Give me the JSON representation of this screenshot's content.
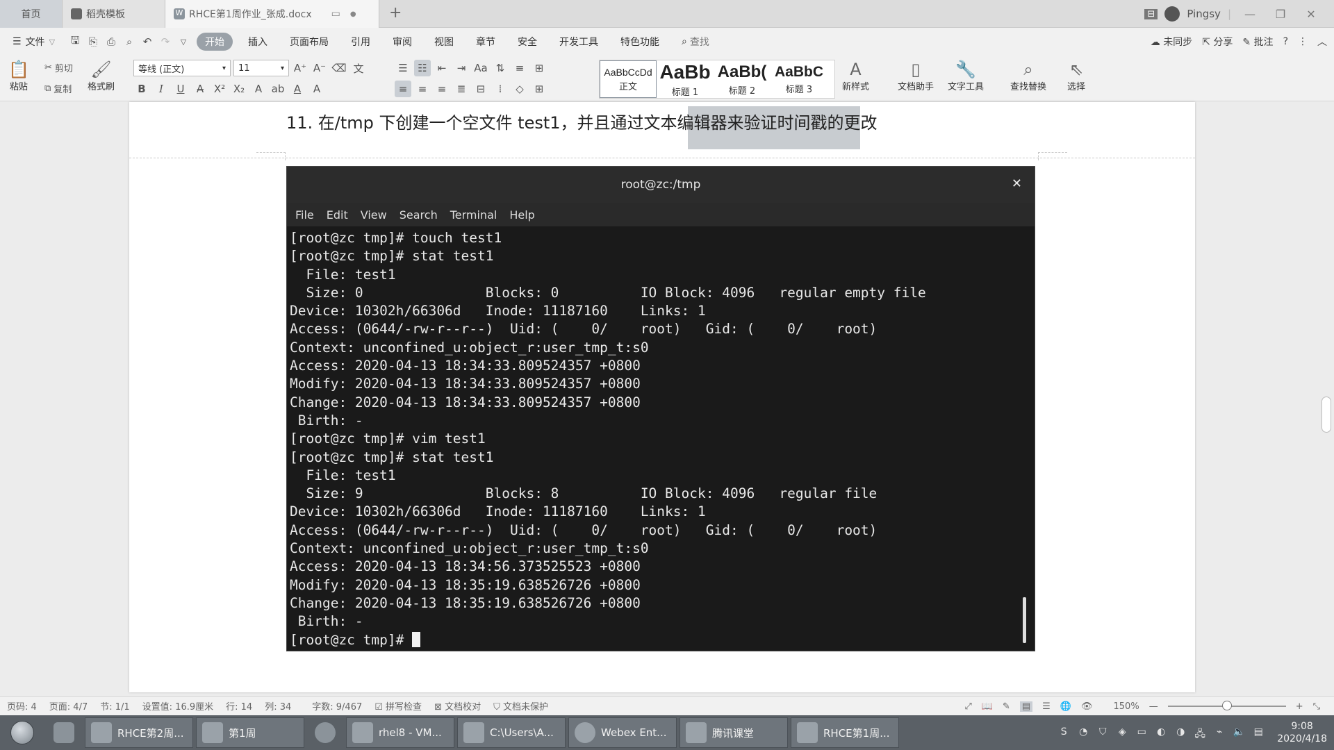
{
  "tabs": {
    "home": "首页",
    "template": "稻壳模板",
    "document": "RHCE第1周作业_张成.docx",
    "add": "+"
  },
  "user": {
    "name": "Pingsy"
  },
  "menu": {
    "file": "文件",
    "items": [
      "开始",
      "插入",
      "页面布局",
      "引用",
      "审阅",
      "视图",
      "章节",
      "安全",
      "开发工具",
      "特色功能"
    ],
    "search": "查找",
    "right": [
      "未同步",
      "分享",
      "批注"
    ]
  },
  "ribbon": {
    "paste": "粘贴",
    "cut": "剪切",
    "copy": "复制",
    "format_painter": "格式刷",
    "font_name": "等线 (正文)",
    "font_size": "11",
    "styles": [
      {
        "sample": "AaBbCcDd",
        "label": "正文"
      },
      {
        "sample": "AaBb",
        "label": "标题 1"
      },
      {
        "sample": "AaBb(",
        "label": "标题 2"
      },
      {
        "sample": "AaBbC",
        "label": "标题 3"
      }
    ],
    "new_style": "新样式",
    "doc_assistant": "文档助手",
    "text_tools": "文字工具",
    "find_replace": "查找替换",
    "select": "选择"
  },
  "document": {
    "heading": "11. 在/tmp 下创建一个空文件 test1，并且通过文本编辑器来验证时间戳的更改"
  },
  "terminal": {
    "title": "root@zc:/tmp",
    "menu": [
      "File",
      "Edit",
      "View",
      "Search",
      "Terminal",
      "Help"
    ],
    "lines": [
      "[root@zc tmp]# touch test1",
      "[root@zc tmp]# stat test1",
      "  File: test1",
      "  Size: 0               Blocks: 0          IO Block: 4096   regular empty file",
      "Device: 10302h/66306d   Inode: 11187160    Links: 1",
      "Access: (0644/-rw-r--r--)  Uid: (    0/    root)   Gid: (    0/    root)",
      "Context: unconfined_u:object_r:user_tmp_t:s0",
      "Access: 2020-04-13 18:34:33.809524357 +0800",
      "Modify: 2020-04-13 18:34:33.809524357 +0800",
      "Change: 2020-04-13 18:34:33.809524357 +0800",
      " Birth: -",
      "[root@zc tmp]# vim test1",
      "[root@zc tmp]# stat test1",
      "  File: test1",
      "  Size: 9               Blocks: 8          IO Block: 4096   regular file",
      "Device: 10302h/66306d   Inode: 11187160    Links: 1",
      "Access: (0644/-rw-r--r--)  Uid: (    0/    root)   Gid: (    0/    root)",
      "Context: unconfined_u:object_r:user_tmp_t:s0",
      "Access: 2020-04-13 18:34:56.373525523 +0800",
      "Modify: 2020-04-13 18:35:19.638526726 +0800",
      "Change: 2020-04-13 18:35:19.638526726 +0800",
      " Birth: -"
    ],
    "prompt": "[root@zc tmp]# "
  },
  "status": {
    "page_num": "页码: 4",
    "pages": "页面: 4/7",
    "section": "节: 1/1",
    "setting": "设置值: 16.9厘米",
    "row": "行: 14",
    "col": "列: 34",
    "words": "字数: 9/467",
    "spell": "拼写检查",
    "proof": "文档校对",
    "protect": "文档未保护",
    "zoom": "150%",
    "zoom_level": 0.5
  },
  "taskbar": {
    "items": [
      "RHCE第2周...",
      "第1周",
      "rhel8 - VM...",
      "C:\\Users\\A...",
      "Webex Ent...",
      "腾讯课堂",
      "RHCE第1周..."
    ],
    "time": "9:08",
    "date": "2020/4/18"
  }
}
